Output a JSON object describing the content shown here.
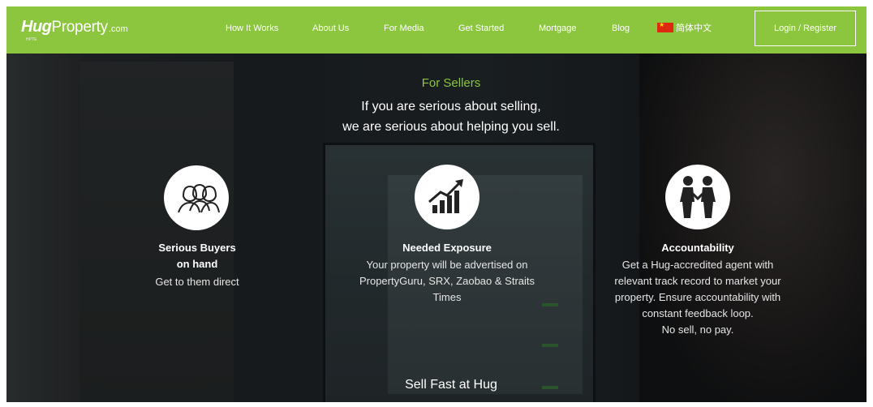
{
  "brand": {
    "hug": "Hug",
    "property": "Property",
    "domain": ".com",
    "subtext": "HPTE",
    "accent_color": "#8cc63f"
  },
  "nav": {
    "links": [
      "How It Works",
      "About Us",
      "For Media",
      "Get Started",
      "Mortgage",
      "Blog"
    ],
    "language_label": "简体中文",
    "language_flag_icon": "china-flag-icon",
    "login_label": "Login / Register"
  },
  "hero": {
    "eyebrow": "For Sellers",
    "headline_line1": "If you are serious about selling,",
    "headline_line2": "we are serious about helping you sell.",
    "features": [
      {
        "icon": "people-group-icon",
        "title_lines": [
          "Serious Buyers",
          "on hand"
        ],
        "desc_lines": [
          "Get to them direct"
        ]
      },
      {
        "icon": "growth-chart-icon",
        "title_lines": [
          "Needed Exposure"
        ],
        "desc_lines": [
          "Your property will be advertised on",
          "PropertyGuru, SRX, Zaobao & Straits",
          "Times"
        ]
      },
      {
        "icon": "handshake-icon",
        "title_lines": [
          "Accountability"
        ],
        "desc_lines": [
          "Get a Hug-accredited agent with",
          "relevant track record to market your",
          "property. Ensure accountability with",
          "constant feedback loop.",
          "No sell, no pay."
        ]
      }
    ],
    "footer_text": "Sell Fast at Hug"
  }
}
